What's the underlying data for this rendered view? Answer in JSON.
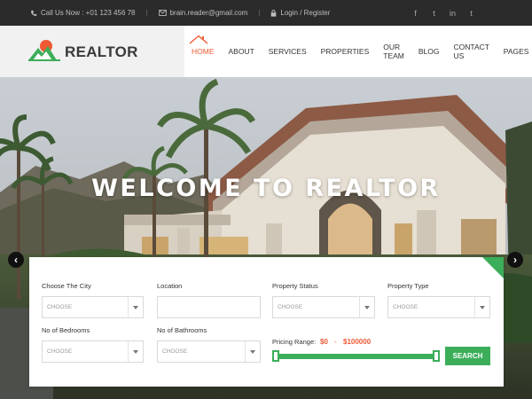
{
  "topbar": {
    "phone": "Call Us Now : +01 123 456 78",
    "email": "brain.reader@gmail.com",
    "login": "Login / Register",
    "social": [
      "f",
      "t",
      "in",
      "t"
    ]
  },
  "brand": {
    "name": "REALTOR",
    "accent": "#ef5a34",
    "green": "#3cae5a"
  },
  "nav": {
    "items": [
      {
        "label": "HOME"
      },
      {
        "label": "ABOUT"
      },
      {
        "label": "SERVICES"
      },
      {
        "label": "PROPERTIES"
      },
      {
        "label": "OUR TEAM"
      },
      {
        "label": "BLOG"
      },
      {
        "label": "CONTACT US"
      },
      {
        "label": "PAGES"
      }
    ],
    "active": "HOME"
  },
  "hero": {
    "title": "WELCOME TO REALTOR",
    "prev": "‹",
    "next": "›"
  },
  "search": {
    "city": {
      "label": "Choose The City",
      "value": "CHOOSE"
    },
    "location": {
      "label": "Location",
      "value": ""
    },
    "status": {
      "label": "Property Status",
      "value": "CHOOSE"
    },
    "type": {
      "label": "Property Type",
      "value": "CHOOSE"
    },
    "bedrooms": {
      "label": "No of Bedrooms",
      "value": "CHOOSE"
    },
    "bathrooms": {
      "label": "No of Bathrooms",
      "value": "CHOOSE"
    },
    "pricing": {
      "label": "Pricing Range:",
      "min": "$0",
      "dash": "-",
      "max": "$100000"
    },
    "button": "SEARCH"
  }
}
